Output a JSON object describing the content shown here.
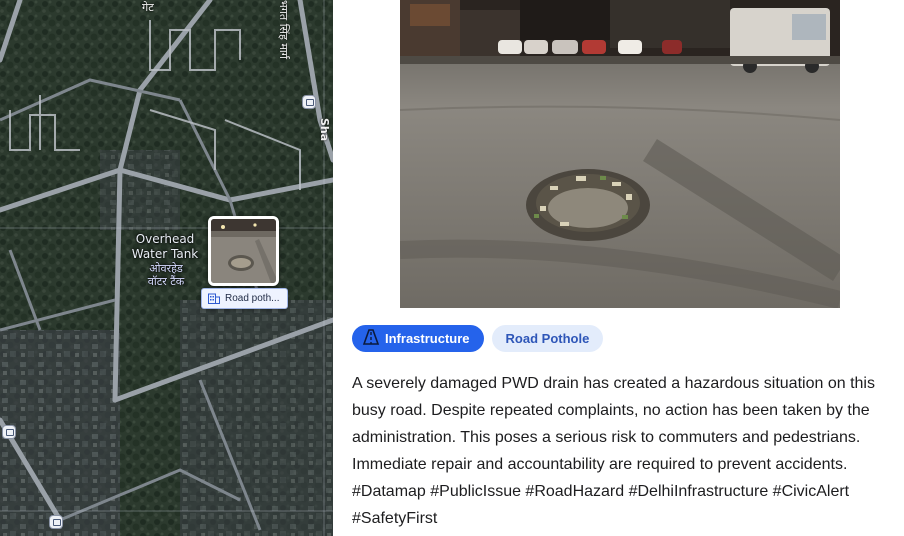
{
  "map": {
    "poi_label_en": [
      "Overhead",
      "Water Tank"
    ],
    "poi_label_hi": [
      "ओवरहेड",
      "वॉटर टैंक"
    ],
    "road_label_hi": "भगत सिंह मार्ग",
    "road_label_en": "Sha",
    "top_label_hi": "गेट",
    "pin": {
      "label": "Road poth...",
      "icon": "building-icon"
    }
  },
  "post": {
    "tags": [
      {
        "label": "Infrastructure",
        "icon": "road-icon",
        "color": "#2563eb"
      },
      {
        "label": "Road Pothole",
        "color": "#e3ecfb"
      }
    ],
    "description_lines": [
      "A severely damaged PWD drain has created a hazardous situation on this",
      "busy road. Despite repeated complaints, no action has been taken by the",
      "administration. This poses a serious risk to commuters and pedestrians.",
      "Immediate repair and accountability are required to prevent accidents.",
      "#Datamap #PublicIssue #RoadHazard #DelhiInfrastructure #CivicAlert",
      "#SafetyFirst"
    ]
  }
}
